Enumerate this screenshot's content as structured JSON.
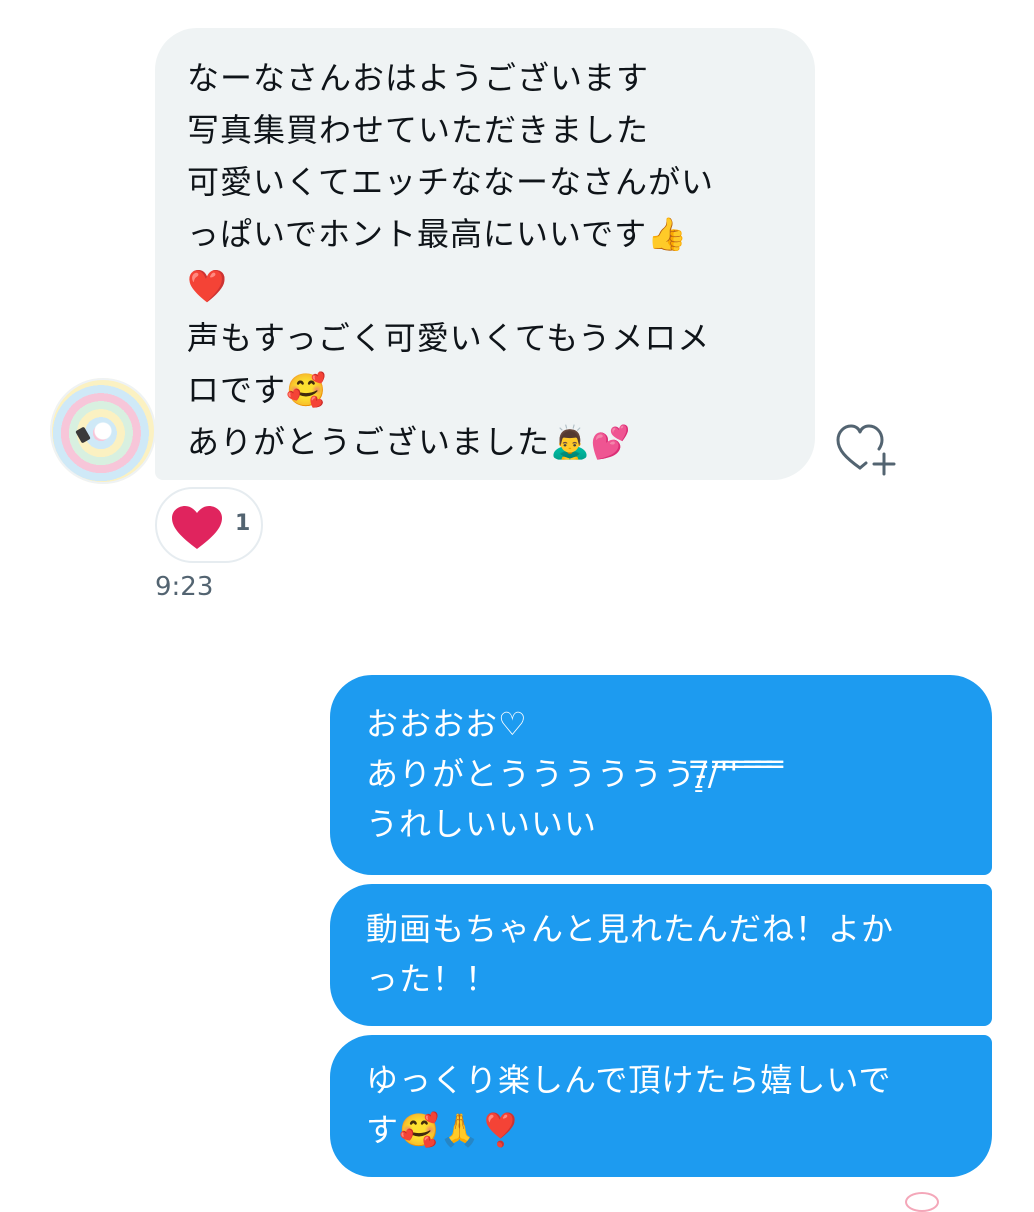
{
  "incoming_message": {
    "lines": [
      "なーなさんおはようございます",
      "写真集買わせていただきました",
      "可愛いくてエッチななーなさんがい",
      "っぱいでホント最高にいいです👍",
      "❤️",
      "声もすっごく可愛いくてもうメロメ",
      "ロです🥰",
      "ありがとうございました🙇‍♂️💕"
    ],
    "reaction": {
      "emoji": "heart",
      "count": "1"
    },
    "timestamp": "9:23"
  },
  "outgoing_messages": [
    {
      "lines": [
        "おおおお♡",
        "ありがとうううううう/̵͇̿̿/'̿'̿ ̿ ̿̿ ̿̿ ̿̿",
        "うれしいいいい"
      ]
    },
    {
      "lines": [
        "動画もちゃんと見れたんだね！よか",
        "った！！"
      ]
    },
    {
      "lines": [
        "ゆっくり楽しんで頂けたら嬉しいで",
        "す🥰🙏❣️"
      ]
    }
  ],
  "colors": {
    "incoming_bubble": "#eff3f4",
    "outgoing_bubble": "#1d9bf0",
    "heart": "#e0245e",
    "timestamp": "#536471"
  },
  "icons": {
    "react_button": "heart-plus-icon",
    "reaction": "heart-icon",
    "avatar": "user-avatar"
  }
}
